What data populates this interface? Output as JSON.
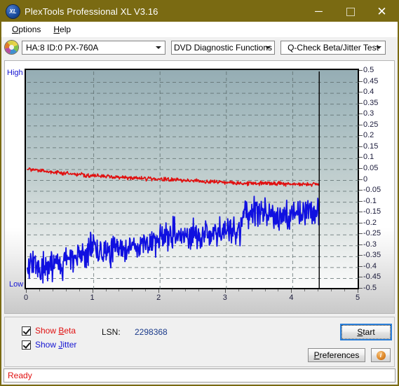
{
  "window": {
    "title": "PlexTools Professional XL V3.16",
    "app_icon": "xl-disc-icon",
    "icon_text": "XL",
    "minimize_label": "─",
    "maximize_label": "",
    "close_label": "✕",
    "titlebar_color": "#7a6a12"
  },
  "menubar": {
    "items": [
      {
        "label": "Options",
        "accel": "O"
      },
      {
        "label": "Help",
        "accel": "H"
      }
    ]
  },
  "toolbar": {
    "drive_icon": "disc-icon",
    "drive": {
      "value": "HA:8 ID:0  PX-760A"
    },
    "function": {
      "value": "DVD Diagnostic Functions"
    },
    "test": {
      "value": "Q-Check Beta/Jitter Test"
    }
  },
  "controls": {
    "show_beta": {
      "label": "Show Beta",
      "accel": "B",
      "checked": true,
      "color": "#e01010"
    },
    "show_jitter": {
      "label": "Show Jitter",
      "accel": "J",
      "checked": true,
      "color": "#1414d2"
    },
    "lsn_label": "LSN:",
    "lsn_value": "2298368",
    "start_button": "Start",
    "start_accel": "S",
    "preferences_button": "Preferences",
    "preferences_accel": "P",
    "info_button": "info-icon",
    "info_glyph": "i"
  },
  "statusbar": {
    "text": "Ready",
    "color": "#e01010"
  },
  "chart_data": {
    "type": "line",
    "title": "Q-Check Beta/Jitter Test",
    "xlabel": "",
    "ylabel": "",
    "xlim": [
      0,
      5
    ],
    "ylim": [
      -0.5,
      0.5
    ],
    "xticks": [
      0,
      1,
      2,
      3,
      4,
      5
    ],
    "yticks": [
      0.5,
      0.45,
      0.4,
      0.35,
      0.3,
      0.25,
      0.2,
      0.15,
      0.1,
      0.05,
      0,
      -0.05,
      -0.1,
      -0.15,
      -0.2,
      -0.25,
      -0.3,
      -0.35,
      -0.4,
      -0.45,
      -0.5
    ],
    "ytick_labels": [
      "0.5",
      "0.45",
      "0.4",
      "0.35",
      "0.3",
      "0.25",
      "0.2",
      "0.15",
      "0.1",
      "0.05",
      "0",
      "-0.05",
      "-0.1",
      "-0.15",
      "-0.2",
      "-0.25",
      "-0.3",
      "-0.35",
      "-0.4",
      "-0.45",
      "-0.5"
    ],
    "axis_high_label": "High",
    "axis_low_label": "Low",
    "grid": true,
    "grid_style": "dashed",
    "grid_color": "#5a6a6a",
    "background_gradient": [
      "#95adb4",
      "#fbfbfb"
    ],
    "data_end_marker_x": 4.4,
    "legend_position": "below-plot",
    "series": [
      {
        "name": "Beta",
        "color": "#e01010",
        "noise": 0.006,
        "x": [
          0.0,
          0.15,
          0.3,
          0.45,
          0.6,
          0.75,
          0.9,
          1.05,
          1.2,
          1.35,
          1.5,
          1.65,
          1.8,
          1.95,
          2.1,
          2.25,
          2.4,
          2.55,
          2.7,
          2.85,
          3.0,
          3.15,
          3.3,
          3.45,
          3.6,
          3.75,
          3.9,
          4.05,
          4.2,
          4.4
        ],
        "values": [
          0.052,
          0.046,
          0.04,
          0.035,
          0.031,
          0.027,
          0.024,
          0.021,
          0.018,
          0.015,
          0.013,
          0.011,
          0.008,
          0.006,
          0.004,
          0.002,
          0.0,
          -0.002,
          -0.004,
          -0.006,
          -0.008,
          -0.011,
          -0.013,
          -0.013,
          -0.013,
          -0.014,
          -0.015,
          -0.016,
          -0.018,
          -0.019
        ]
      },
      {
        "name": "Jitter",
        "color": "#1010e0",
        "noise": 0.045,
        "x": [
          0.0,
          0.1,
          0.2,
          0.3,
          0.4,
          0.5,
          0.6,
          0.7,
          0.8,
          0.9,
          1.0,
          1.1,
          1.2,
          1.3,
          1.4,
          1.5,
          1.6,
          1.7,
          1.8,
          1.9,
          2.0,
          2.1,
          2.2,
          2.3,
          2.4,
          2.5,
          2.6,
          2.7,
          2.8,
          2.9,
          3.0,
          3.1,
          3.2,
          3.25,
          3.35,
          3.45,
          3.55,
          3.65,
          3.75,
          3.85,
          3.95,
          4.05,
          4.15,
          4.25,
          4.35,
          4.4
        ],
        "values": [
          -0.41,
          -0.4,
          -0.398,
          -0.392,
          -0.386,
          -0.38,
          -0.372,
          -0.362,
          -0.348,
          -0.33,
          -0.312,
          -0.32,
          -0.328,
          -0.324,
          -0.318,
          -0.312,
          -0.3,
          -0.292,
          -0.286,
          -0.276,
          -0.262,
          -0.25,
          -0.24,
          -0.238,
          -0.25,
          -0.262,
          -0.258,
          -0.248,
          -0.242,
          -0.236,
          -0.234,
          -0.238,
          -0.246,
          -0.16,
          -0.15,
          -0.148,
          -0.15,
          -0.156,
          -0.172,
          -0.186,
          -0.178,
          -0.16,
          -0.15,
          -0.148,
          -0.15,
          -0.152
        ]
      }
    ]
  }
}
